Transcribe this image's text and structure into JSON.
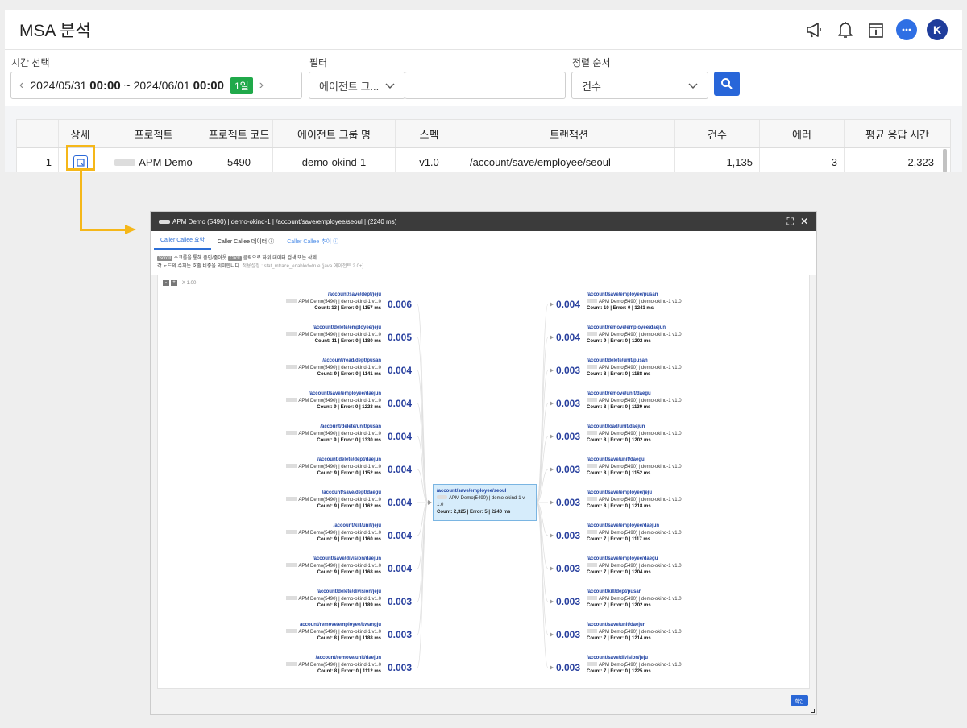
{
  "header": {
    "title": "MSA 분석",
    "avatar_letter": "K"
  },
  "filters": {
    "time_label": "시간 선택",
    "date_start": "2024/05/31",
    "time_start": "00:00",
    "date_sep": "~",
    "date_end": "2024/06/01",
    "time_end": "00:00",
    "day_badge": "1일",
    "filter_label": "필터",
    "filter_select": "에이전트 그...",
    "filter_input_value": "",
    "sort_label": "정렬 순서",
    "sort_select": "건수"
  },
  "table": {
    "headers": [
      "",
      "상세",
      "프로젝트",
      "프로젝트 코드",
      "에이전트 그룹 명",
      "스펙",
      "트랜잭션",
      "건수",
      "에러",
      "평균 응답 시간"
    ],
    "row": {
      "index": "1",
      "project": "APM Demo",
      "project_code": "5490",
      "agent_group": "demo-okind-1",
      "spec": "v1.0",
      "transaction": "/account/save/employee/seoul",
      "count": "1,135",
      "error": "3",
      "avg_response": "2,323"
    }
  },
  "modal": {
    "title": "APM Demo (5490) | demo-okind-1 | /account/save/employee/seoul | (2240 ms)",
    "tabs": [
      "Caller Callee 요약",
      "Caller Callee 데이터",
      "Caller Callee 추이"
    ],
    "info_scroll_key": "Scroll",
    "info_scroll_text": "스크롤을 통해 줌인/줌아웃",
    "info_click_key": "Click",
    "info_click_text": "클릭으로 하위 데이터 검색 또는 삭제",
    "info_line2": "각 노드의 수치는 호출 비중을 의미합니다.",
    "info_line2_muted": "적용설정 : stat_mtrace_enabled=true (java 에이전트 2.0+)",
    "zoom_minus": "-",
    "zoom_plus": "+",
    "zoom_level": "X 1.00",
    "ok_label": "확인",
    "center": {
      "path": "/account/save/employee/seoul",
      "sub": "APM Demo(5490) | demo-okind-1 v",
      "sub2": "1.0",
      "count": "Count: 2,325 | Error: 5 | 2240 ms"
    },
    "callers": [
      {
        "path": "/account/save/dept/jeju",
        "sub": "APM Demo(5490) | demo-okind-1 v1.0",
        "count": "Count: 13 | Error: 0 | 1157 ms",
        "value": "0.006"
      },
      {
        "path": "/account/delete/employee/jeju",
        "sub": "APM Demo(5490) | demo-okind-1 v1.0",
        "count": "Count: 11 | Error: 0 | 1180 ms",
        "value": "0.005"
      },
      {
        "path": "/account/read/dept/pusan",
        "sub": "APM Demo(5490) | demo-okind-1 v1.0",
        "count": "Count: 9 | Error: 0 | 1141 ms",
        "value": "0.004"
      },
      {
        "path": "/account/save/employee/daejun",
        "sub": "APM Demo(5490) | demo-okind-1 v1.0",
        "count": "Count: 9 | Error: 0 | 1223 ms",
        "value": "0.004"
      },
      {
        "path": "/account/delete/unit/pusan",
        "sub": "APM Demo(5490) | demo-okind-1 v1.0",
        "count": "Count: 9 | Error: 0 | 1330 ms",
        "value": "0.004"
      },
      {
        "path": "/account/delete/dept/daejun",
        "sub": "APM Demo(5490) | demo-okind-1 v1.0",
        "count": "Count: 9 | Error: 0 | 1152 ms",
        "value": "0.004"
      },
      {
        "path": "/account/save/dept/daegu",
        "sub": "APM Demo(5490) | demo-okind-1 v1.0",
        "count": "Count: 9 | Error: 0 | 1162 ms",
        "value": "0.004"
      },
      {
        "path": "/account/kill/unit/jeju",
        "sub": "APM Demo(5490) | demo-okind-1 v1.0",
        "count": "Count: 9 | Error: 0 | 1160 ms",
        "value": "0.004"
      },
      {
        "path": "/account/save/division/daejun",
        "sub": "APM Demo(5490) | demo-okind-1 v1.0",
        "count": "Count: 9 | Error: 0 | 1168 ms",
        "value": "0.004"
      },
      {
        "path": "/account/delete/division/jeju",
        "sub": "APM Demo(5490) | demo-okind-1 v1.0",
        "count": "Count: 8 | Error: 0 | 1189 ms",
        "value": "0.003"
      },
      {
        "path": "account/remove/employee/kwangju",
        "sub": "APM Demo(5490) | demo-okind-1 v1.0",
        "count": "Count: 8 | Error: 0 | 1188 ms",
        "value": "0.003"
      },
      {
        "path": "/account/remove/unit/daejun",
        "sub": "APM Demo(5490) | demo-okind-1 v1.0",
        "count": "Count: 8 | Error: 0 | 1112 ms",
        "value": "0.003"
      }
    ],
    "callees": [
      {
        "path": "/account/save/employee/pusan",
        "sub": "APM Demo(5490) | demo-okind-1 v1.0",
        "count": "Count: 10 | Error: 0 | 1241 ms",
        "value": "0.004"
      },
      {
        "path": "/account/remove/employee/daejun",
        "sub": "APM Demo(5490) | demo-okind-1 v1.0",
        "count": "Count: 9 | Error: 0 | 1202 ms",
        "value": "0.004"
      },
      {
        "path": "/account/delete/unit/pusan",
        "sub": "APM Demo(5490) | demo-okind-1 v1.0",
        "count": "Count: 8 | Error: 0 | 1188 ms",
        "value": "0.003"
      },
      {
        "path": "/account/remove/unit/daegu",
        "sub": "APM Demo(5490) | demo-okind-1 v1.0",
        "count": "Count: 8 | Error: 0 | 1139 ms",
        "value": "0.003"
      },
      {
        "path": "/account/load/unit/daejun",
        "sub": "APM Demo(5490) | demo-okind-1 v1.0",
        "count": "Count: 8 | Error: 0 | 1202 ms",
        "value": "0.003"
      },
      {
        "path": "/account/save/unit/daegu",
        "sub": "APM Demo(5490) | demo-okind-1 v1.0",
        "count": "Count: 8 | Error: 0 | 1152 ms",
        "value": "0.003"
      },
      {
        "path": "/account/save/employee/jeju",
        "sub": "APM Demo(5490) | demo-okind-1 v1.0",
        "count": "Count: 8 | Error: 0 | 1218 ms",
        "value": "0.003"
      },
      {
        "path": "/account/save/employee/daejun",
        "sub": "APM Demo(5490) | demo-okind-1 v1.0",
        "count": "Count: 7 | Error: 0 | 1117 ms",
        "value": "0.003"
      },
      {
        "path": "/account/save/employee/daegu",
        "sub": "APM Demo(5490) | demo-okind-1 v1.0",
        "count": "Count: 7 | Error: 0 | 1204 ms",
        "value": "0.003"
      },
      {
        "path": "/account/kill/dept/pusan",
        "sub": "APM Demo(5490) | demo-okind-1 v1.0",
        "count": "Count: 7 | Error: 0 | 1202 ms",
        "value": "0.003"
      },
      {
        "path": "/account/save/unit/daejun",
        "sub": "APM Demo(5490) | demo-okind-1 v1.0",
        "count": "Count: 7 | Error: 0 | 1214 ms",
        "value": "0.003"
      },
      {
        "path": "/account/save/division/jeju",
        "sub": "APM Demo(5490) | demo-okind-1 v1.0",
        "count": "Count: 7 | Error: 0 | 1225 ms",
        "value": "0.003"
      }
    ]
  }
}
